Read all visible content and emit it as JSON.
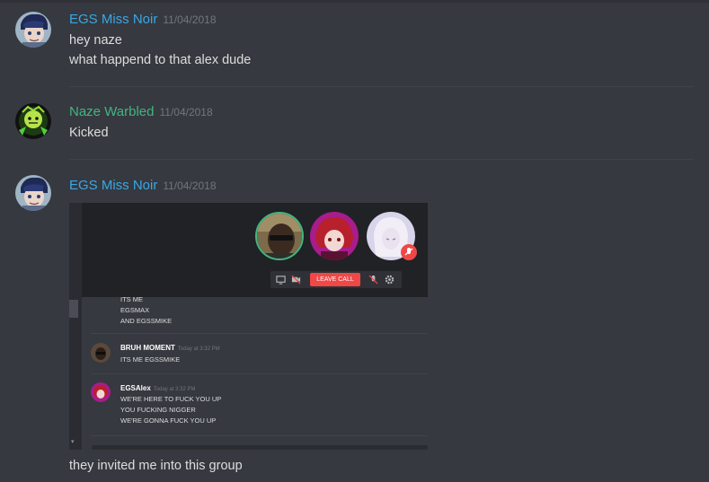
{
  "messages": [
    {
      "author": "EGS Miss Noir",
      "timestamp": "11/04/2018",
      "lines": [
        "hey naze",
        "what happend to that alex dude"
      ]
    },
    {
      "author": "Naze Warbled",
      "timestamp": "11/04/2018",
      "lines": [
        "Kicked"
      ]
    },
    {
      "author": "EGS Miss Noir",
      "timestamp": "11/04/2018",
      "lines": [
        "they invited me into this group"
      ]
    }
  ],
  "attachment": {
    "leave_call_label": "LEAVE CALL",
    "earlier_lines": [
      "ITS ME",
      "EGSMAX",
      "AND EGSSMIKE"
    ],
    "inner_messages": [
      {
        "author": "BRUH MOMENT",
        "timestamp": "Today at 3:32 PM",
        "lines": [
          "ITS ME EGSSMIKE"
        ]
      },
      {
        "author": "EGSAlex",
        "timestamp": "Today at 3:32 PM",
        "lines": [
          "WE'RE HERE TO FUCK YOU UP",
          "YOU FUCKING NIGGER",
          "WE'RE GONNA FUCK YOU UP"
        ]
      }
    ]
  },
  "colors": {
    "background": "#36393f",
    "author_blue": "#3aa7e6",
    "author_green": "#43b581",
    "leave_call_red": "#f04747"
  },
  "icons": [
    "screen-share-icon",
    "video-off-icon",
    "mic-muted-icon",
    "settings-gear-icon",
    "scroll-up-arrow-icon",
    "scroll-down-arrow-icon"
  ]
}
